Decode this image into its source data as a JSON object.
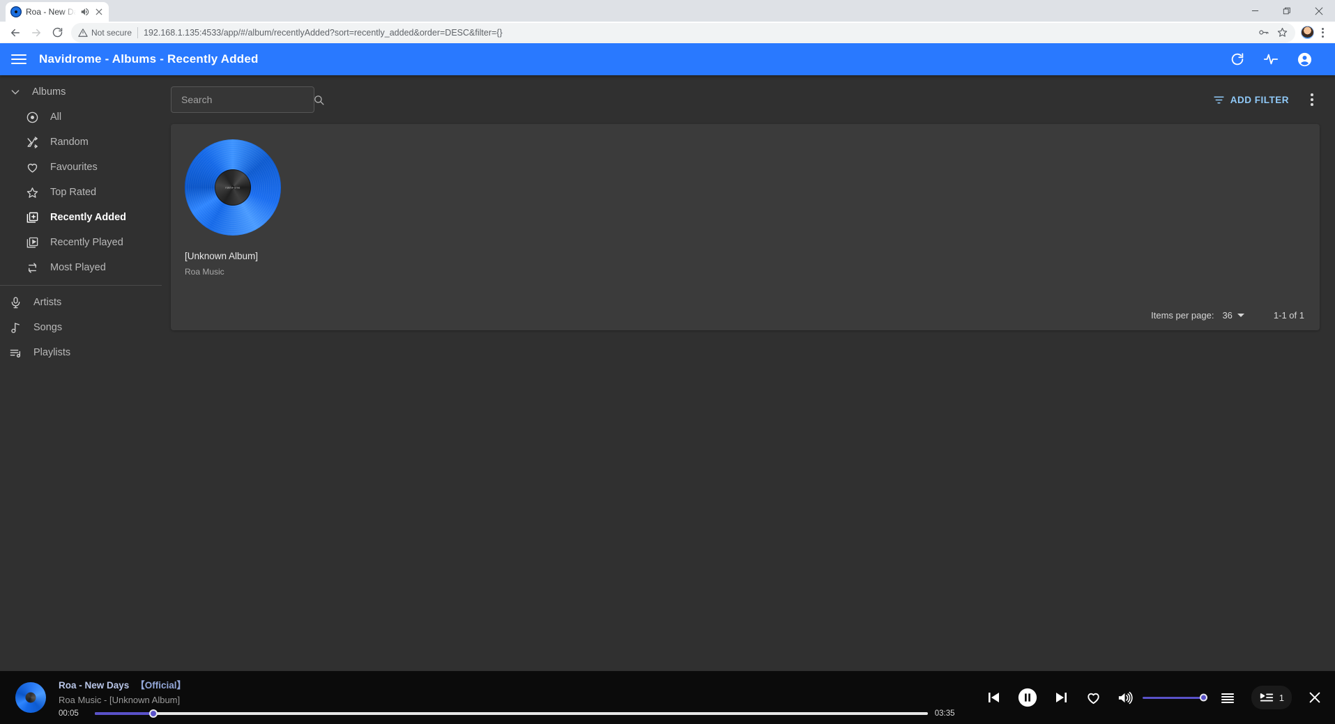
{
  "browser": {
    "tab": {
      "title": "Roa - New Day",
      "favicon_icon": "vinyl-record-icon",
      "audio_icon": "speaker-playing-icon",
      "close_icon": "close-icon"
    },
    "window_controls": {
      "minimize_icon": "minimize-icon",
      "maximize_icon": "maximize-icon",
      "close_icon": "close-icon"
    },
    "nav": {
      "back_icon": "arrow-back-icon",
      "forward_icon": "arrow-forward-icon",
      "reload_icon": "reload-icon"
    },
    "omnibox": {
      "security_icon": "warning-triangle-icon",
      "security_label": "Not secure",
      "url": "192.168.1.135:4533/app/#/album/recentlyAdded?sort=recently_added&order=DESC&filter={}",
      "password_key_icon": "key-icon",
      "bookmark_icon": "star-outline-icon"
    },
    "profile_icon": "account-avatar-icon",
    "menu_icon": "chrome-menu-icon"
  },
  "appbar": {
    "menu_icon": "hamburger-menu-icon",
    "title": "Navidrome - Albums - Recently Added",
    "actions": [
      {
        "name": "refresh-icon"
      },
      {
        "name": "activity-pulse-icon"
      },
      {
        "name": "account-circle-icon"
      }
    ]
  },
  "sidebar": {
    "group": {
      "label": "Albums",
      "expand_icon": "chevron-down-icon"
    },
    "album_items": [
      {
        "label": "All",
        "icon": "album-disc-icon",
        "active": false
      },
      {
        "label": "Random",
        "icon": "shuffle-icon",
        "active": false
      },
      {
        "label": "Favourites",
        "icon": "heart-outline-icon",
        "active": false
      },
      {
        "label": "Top Rated",
        "icon": "star-outline-icon",
        "active": false
      },
      {
        "label": "Recently Added",
        "icon": "library-add-icon",
        "active": true
      },
      {
        "label": "Recently Played",
        "icon": "library-play-icon",
        "active": false
      },
      {
        "label": "Most Played",
        "icon": "repeat-icon",
        "active": false
      }
    ],
    "root_items": [
      {
        "label": "Artists",
        "icon": "microphone-icon"
      },
      {
        "label": "Songs",
        "icon": "music-note-icon"
      },
      {
        "label": "Playlists",
        "icon": "playlist-icon"
      }
    ]
  },
  "toolbar": {
    "search_placeholder": "Search",
    "search_value": "",
    "search_icon": "search-icon",
    "add_filter_label": "ADD FILTER",
    "filter_icon": "filter-icon",
    "more_icon": "more-vert-icon"
  },
  "albums": [
    {
      "title": "[Unknown Album]",
      "artist": "Roa Music",
      "cover_icon": "blue-vinyl-record-placeholder",
      "cover_label_text": "navidrome"
    }
  ],
  "pagination": {
    "items_per_page_label": "Items per page:",
    "items_per_page_value": "36",
    "dropdown_icon": "caret-down-icon",
    "range_label": "1-1 of 1"
  },
  "player": {
    "cover_icon": "blue-vinyl-record-icon",
    "track_title": "Roa - New Days",
    "track_tag": "【Official】",
    "track_subtitle": "Roa Music - [Unknown Album]",
    "current_time": "00:05",
    "total_time": "03:35",
    "progress_percent": 7,
    "controls": [
      {
        "name": "previous-track-button",
        "icon": "skip-previous-icon"
      },
      {
        "name": "pause-button",
        "icon": "pause-circle-icon"
      },
      {
        "name": "next-track-button",
        "icon": "skip-next-icon"
      },
      {
        "name": "favourite-button",
        "icon": "heart-outline-icon"
      },
      {
        "name": "volume-button",
        "icon": "volume-up-icon"
      }
    ],
    "volume_percent": 100,
    "queue_icon": "queue-list-icon",
    "playlist_icon": "playlist-play-icon",
    "queue_count": "1",
    "close_icon": "close-icon"
  },
  "colors": {
    "accent_blue": "#2979ff",
    "link_blue": "#90caf9",
    "player_purple": "#5a52c9",
    "surface": "#3b3b3b",
    "background": "#303030"
  }
}
